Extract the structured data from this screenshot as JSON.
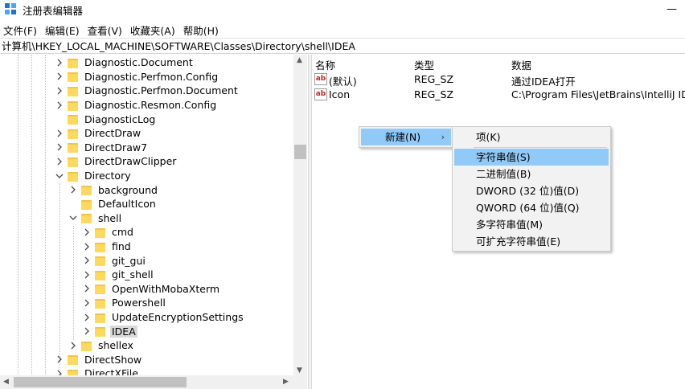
{
  "window": {
    "title": "注册表编辑器",
    "minimize_glyph": "—"
  },
  "menubar": [
    {
      "label": "文件(F)"
    },
    {
      "label": "编辑(E)"
    },
    {
      "label": "查看(V)"
    },
    {
      "label": "收藏夹(A)"
    },
    {
      "label": "帮助(H)"
    }
  ],
  "address": "计算机\\HKEY_LOCAL_MACHINE\\SOFTWARE\\Classes\\Directory\\shell\\IDEA",
  "tree": {
    "items": [
      {
        "label": "Diagnostic.Document",
        "state": "collapsed",
        "level": 0
      },
      {
        "label": "Diagnostic.Perfmon.Config",
        "state": "collapsed",
        "level": 0
      },
      {
        "label": "Diagnostic.Perfmon.Document",
        "state": "collapsed",
        "level": 0
      },
      {
        "label": "Diagnostic.Resmon.Config",
        "state": "collapsed",
        "level": 0
      },
      {
        "label": "DiagnosticLog",
        "state": "leaf",
        "level": 0
      },
      {
        "label": "DirectDraw",
        "state": "collapsed",
        "level": 0
      },
      {
        "label": "DirectDraw7",
        "state": "collapsed",
        "level": 0
      },
      {
        "label": "DirectDrawClipper",
        "state": "collapsed",
        "level": 0
      },
      {
        "label": "Directory",
        "state": "expanded",
        "level": 0
      },
      {
        "label": "background",
        "state": "collapsed",
        "level": 1
      },
      {
        "label": "DefaultIcon",
        "state": "leaf",
        "level": 1
      },
      {
        "label": "shell",
        "state": "expanded",
        "level": 1
      },
      {
        "label": "cmd",
        "state": "collapsed",
        "level": 2
      },
      {
        "label": "find",
        "state": "collapsed",
        "level": 2
      },
      {
        "label": "git_gui",
        "state": "collapsed",
        "level": 2
      },
      {
        "label": "git_shell",
        "state": "collapsed",
        "level": 2
      },
      {
        "label": "OpenWithMobaXterm",
        "state": "collapsed",
        "level": 2
      },
      {
        "label": "Powershell",
        "state": "collapsed",
        "level": 2
      },
      {
        "label": "UpdateEncryptionSettings",
        "state": "collapsed",
        "level": 2
      },
      {
        "label": "IDEA",
        "state": "collapsed",
        "level": 2,
        "selected": true
      },
      {
        "label": "shellex",
        "state": "collapsed",
        "level": 1
      },
      {
        "label": "DirectShow",
        "state": "collapsed",
        "level": 0
      },
      {
        "label": "DirectXFile",
        "state": "collapsed",
        "level": 0
      }
    ]
  },
  "values_pane": {
    "headers": {
      "name": "名称",
      "type": "类型",
      "data": "数据"
    },
    "rows": [
      {
        "name": "(默认)",
        "type": "REG_SZ",
        "data": "通过IDEA打开",
        "icon": "ab-string-icon"
      },
      {
        "name": "Icon",
        "type": "REG_SZ",
        "data": "C:\\Program Files\\JetBrains\\IntelliJ IDE",
        "icon": "ab-string-icon"
      }
    ]
  },
  "context_menu": {
    "new_label": "新建(N)",
    "submenu": [
      {
        "label": "项(K)"
      },
      {
        "label": "字符串值(S)",
        "highlighted": true
      },
      {
        "label": "二进制值(B)"
      },
      {
        "label": "DWORD (32 位)值(D)"
      },
      {
        "label": "QWORD (64 位)值(Q)"
      },
      {
        "label": "多字符串值(M)"
      },
      {
        "label": "可扩充字符串值(E)"
      }
    ]
  },
  "colors": {
    "highlight": "#91c9f7",
    "folder": "#ffd95c",
    "selected_tree": "#d9d9d9"
  }
}
